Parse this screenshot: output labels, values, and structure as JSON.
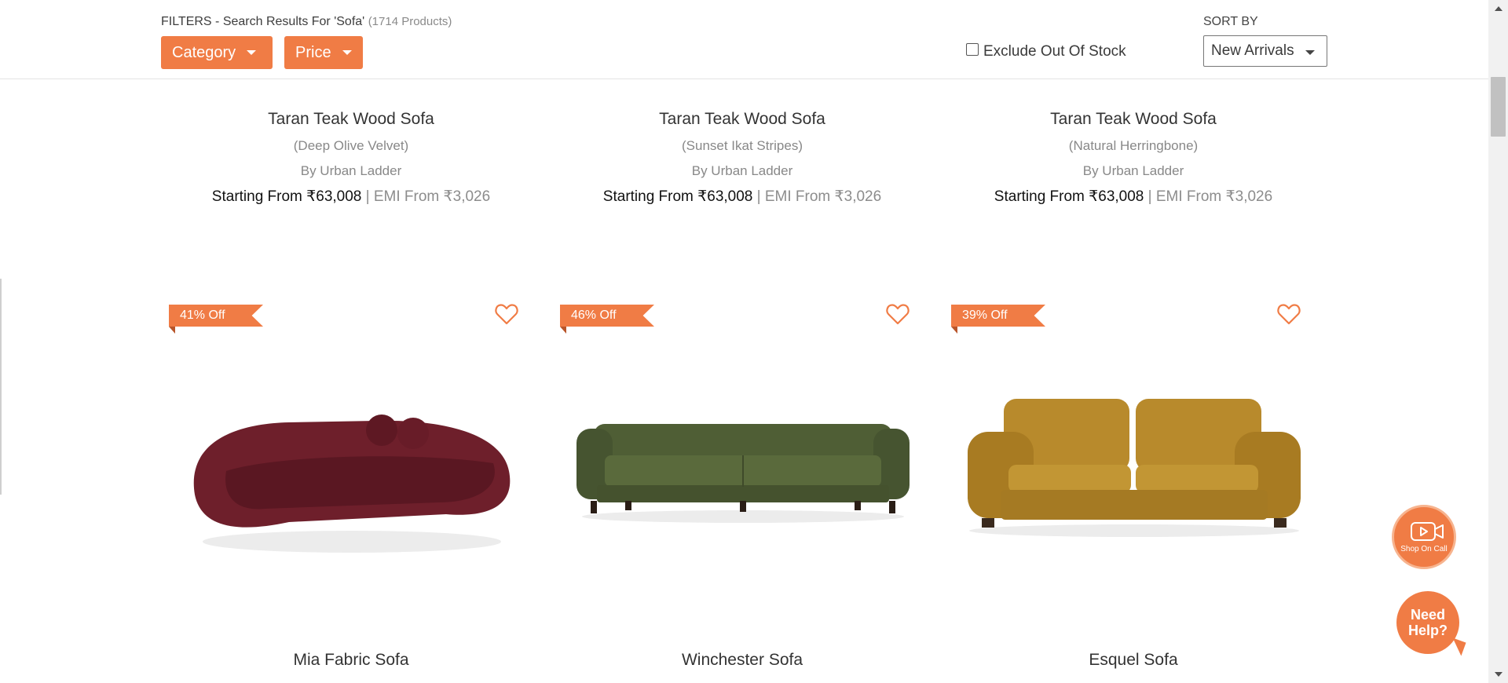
{
  "filters": {
    "title": "FILTERS - Search Results For 'Sofa'",
    "count": "(1714 Products)",
    "category_label": "Category",
    "price_label": "Price",
    "exclude_label": "Exclude Out Of Stock",
    "exclude_checked": false,
    "sort_by_label": "SORT BY",
    "sort_value": "New Arrivals"
  },
  "row1": [
    {
      "name": "Taran Teak Wood Sofa",
      "variant": "(Deep Olive Velvet)",
      "brand": "By Urban Ladder",
      "price_prefix": "Starting From ",
      "price": "₹63,008",
      "sep": " | ",
      "emi": "EMI From ₹3,026"
    },
    {
      "name": "Taran Teak Wood Sofa",
      "variant": "(Sunset Ikat Stripes)",
      "brand": "By Urban Ladder",
      "price_prefix": "Starting From ",
      "price": "₹63,008",
      "sep": " | ",
      "emi": "EMI From ₹3,026"
    },
    {
      "name": "Taran Teak Wood Sofa",
      "variant": "(Natural Herringbone)",
      "brand": "By Urban Ladder",
      "price_prefix": "Starting From ",
      "price": "₹63,008",
      "sep": " | ",
      "emi": "EMI From ₹3,026"
    }
  ],
  "row2": [
    {
      "name": "Mia Fabric Sofa",
      "discount": "41% Off",
      "color": "#6e1f2b"
    },
    {
      "name": "Winchester Sofa",
      "discount": "46% Off",
      "color": "#4f5e35"
    },
    {
      "name": "Esquel Sofa",
      "discount": "39% Off",
      "color": "#b88a2c"
    }
  ],
  "floating": {
    "shop_on_call": "Shop On Call",
    "need_help": "Need Help?"
  },
  "colors": {
    "accent": "#f07c45"
  }
}
